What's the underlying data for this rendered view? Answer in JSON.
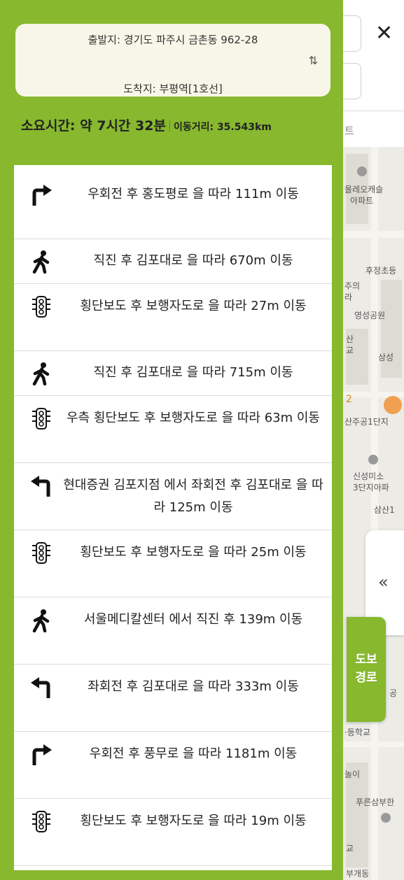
{
  "route": {
    "from_label": "출발지: 경기도 파주시 금촌동 962-28",
    "to_label": "도착지: 부평역[1호선]",
    "swap_icon": "⇅",
    "duration": "소요시간: 약 7시간 32분",
    "distance": "이동거리: 35.543km"
  },
  "map": {
    "tab_fragment": "트",
    "labels": [
      "올레오캐슬",
      "아파트",
      "후정초등",
      "주의",
      "라",
      "영성공원",
      "산",
      "교",
      "상성",
      "2",
      "산주공1단지",
      "신성미소",
      "3단지아파",
      "삼산1",
      "공",
      "·등학교",
      "놀이",
      "푸른삼부한",
      "교",
      "부개동"
    ],
    "collapse_icon": "«",
    "walk_tab_label": "도보 경로"
  },
  "steps": [
    {
      "icon": "turn-right-icon",
      "text": "우회전 후 홍도평로 을 따라 111m 이동"
    },
    {
      "icon": "pedestrian-icon",
      "text": "직진 후 김포대로 을 따라 670m 이동"
    },
    {
      "icon": "traffic-light-icon",
      "text": "횡단보도 후 보행자도로 을 따라 27m 이동"
    },
    {
      "icon": "pedestrian-icon",
      "text": "직진 후 김포대로 을 따라 715m 이동"
    },
    {
      "icon": "traffic-light-icon",
      "text": "우측 횡단보도 후 보행자도로 을 따라 63m 이동"
    },
    {
      "icon": "turn-left-icon",
      "text": "현대증권 김포지점 에서 좌회전 후 김포대로 을 따라 125m 이동"
    },
    {
      "icon": "traffic-light-icon",
      "text": "횡단보도 후 보행자도로 을 따라 25m 이동"
    },
    {
      "icon": "pedestrian-icon",
      "text": "서울메디칼센터 에서 직진 후 139m 이동"
    },
    {
      "icon": "turn-left-icon",
      "text": "좌회전 후 김포대로 을 따라 333m 이동"
    },
    {
      "icon": "turn-right-icon",
      "text": "우회전 후 풍무로 을 따라 1181m 이동"
    },
    {
      "icon": "traffic-light-icon",
      "text": "횡단보도 후 보행자도로 을 따라 19m 이동"
    }
  ]
}
